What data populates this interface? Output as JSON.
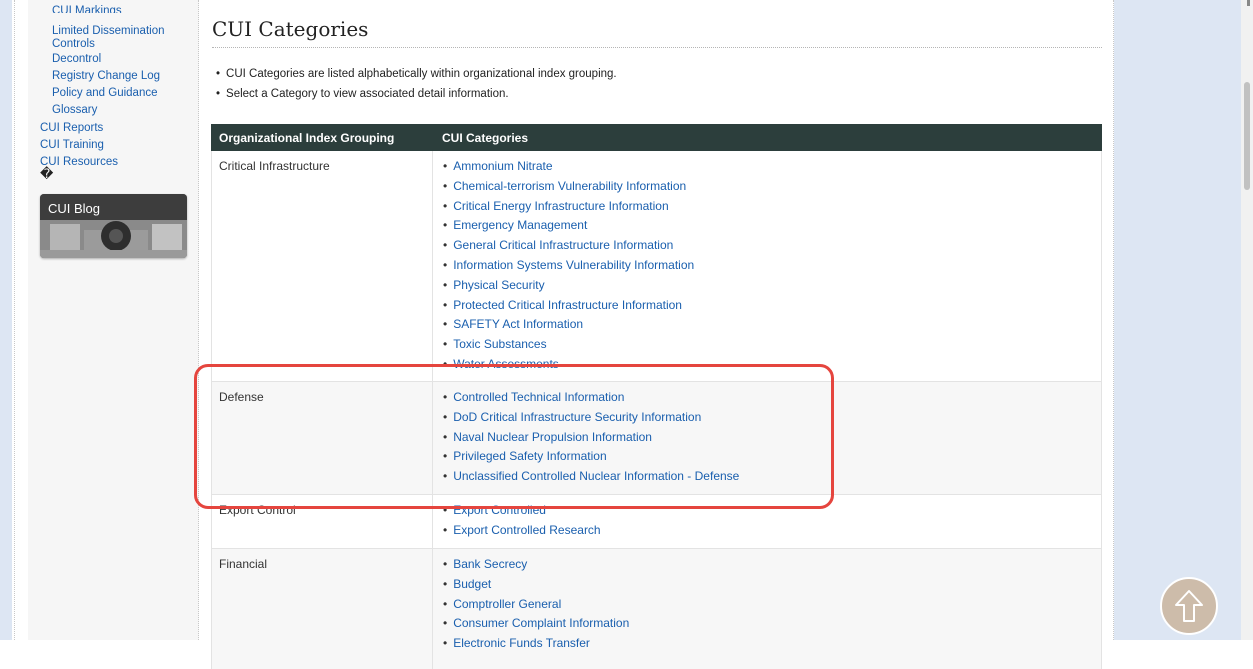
{
  "sidebar": {
    "items": [
      {
        "label": "CUI Markings"
      },
      {
        "label": "Limited Dissemination Controls"
      },
      {
        "label": "Decontrol"
      },
      {
        "label": "Registry Change Log"
      },
      {
        "label": "Policy and Guidance"
      },
      {
        "label": "Glossary"
      },
      {
        "label": "CUI Reports"
      },
      {
        "label": "CUI Training"
      },
      {
        "label": "CUI Resources"
      }
    ],
    "odd_glyph": "�",
    "blog_label": "CUI Blog"
  },
  "main": {
    "title": "CUI Categories",
    "intro": [
      "CUI Categories are listed alphabetically within organizational index grouping.",
      "Select a Category to view associated detail information."
    ],
    "table": {
      "headers": [
        "Organizational Index Grouping",
        "CUI Categories"
      ],
      "rows": [
        {
          "group": "Critical Infrastructure",
          "categories": [
            "Ammonium Nitrate",
            "Chemical-terrorism Vulnerability Information",
            "Critical Energy Infrastructure Information",
            "Emergency Management",
            "General Critical Infrastructure Information",
            "Information Systems Vulnerability Information",
            "Physical Security",
            "Protected Critical Infrastructure Information",
            "SAFETY Act Information",
            "Toxic Substances",
            "Water Assessments"
          ]
        },
        {
          "group": "Defense",
          "categories": [
            "Controlled Technical Information",
            "DoD Critical Infrastructure Security Information",
            "Naval Nuclear Propulsion Information",
            "Privileged Safety Information",
            "Unclassified Controlled Nuclear Information - Defense"
          ]
        },
        {
          "group": "Export Control",
          "categories": [
            "Export Controlled",
            "Export Controlled Research"
          ]
        },
        {
          "group": "Financial",
          "categories": [
            "Bank Secrecy",
            "Budget",
            "Comptroller General",
            "Consumer Complaint Information",
            "Electronic Funds Transfer"
          ]
        }
      ]
    }
  },
  "colors": {
    "link": "#1a5fae",
    "table_header_bg": "#2c3e3c",
    "highlight": "#e5453e",
    "side_bg": "#dde6f3",
    "back_to_top": "#cdbcaa"
  },
  "icons": {
    "back_to_top": "up-arrow-circle-icon"
  }
}
